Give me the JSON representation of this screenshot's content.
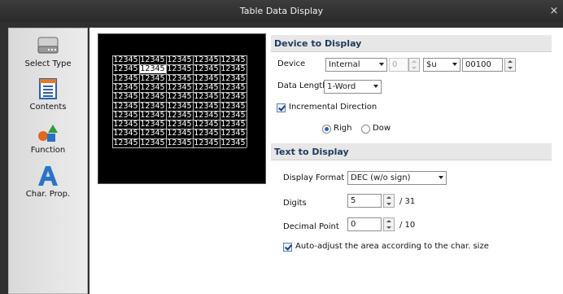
{
  "window": {
    "title": "Table Data Display",
    "close_glyph": "×"
  },
  "sidebar": {
    "items": [
      {
        "label": "Select Type",
        "icon": "keyboard-icon"
      },
      {
        "label": "Contents",
        "icon": "table-icon"
      },
      {
        "label": "Function",
        "icon": "shapes-icon"
      },
      {
        "label": "Char. Prop.",
        "icon": "letter-a-icon"
      }
    ]
  },
  "preview": {
    "cell_text": "12345",
    "rows": 10,
    "cols": 5,
    "selected_cell": [
      1,
      1
    ]
  },
  "device_section": {
    "header": "Device to Display",
    "device_label": "Device",
    "device_value": "Internal",
    "device_number": "0",
    "device_prefix": "$u",
    "address": "00100",
    "length_label": "Data Length",
    "length_value": "1-Word",
    "incremental_label": "Incremental Direction",
    "incremental_checked": true,
    "dir_right_label": "Righ",
    "dir_down_label": "Dow",
    "selected_direction": "right"
  },
  "text_section": {
    "header": "Text to Display",
    "format_label": "Display Format",
    "format_value": "DEC (w/o sign)",
    "digits_label": "Digits",
    "digits_value": "5",
    "digits_max": "/ 31",
    "decimal_label": "Decimal Point",
    "decimal_value": "0",
    "decimal_max": "/ 10",
    "auto_adjust_label": "Auto-adjust the area according to the char. size",
    "auto_adjust_checked": true
  }
}
